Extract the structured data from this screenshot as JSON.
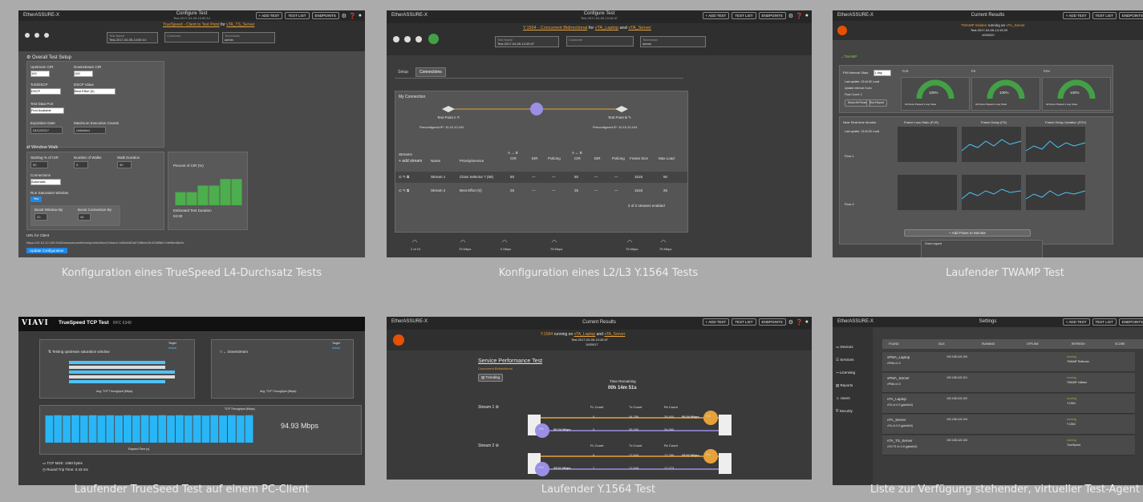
{
  "captions": [
    "Konfiguration eines TrueSpeed L4-Durchsatz Tests",
    "Konfiguration eines L2/L3 Y.1564 Tests",
    "Laufender TWAMP Test",
    "Laufender TrueSeed Test auf einem PC-Client",
    "Laufender Y.1564 Test",
    "Liste zur Verfügung stehender, virtueller Test-Agent"
  ],
  "common": {
    "logo": "EtherASSURE-X",
    "add_test": "+ ADD TEST",
    "test_list": "TEST LIST",
    "endpoints": "ENDPOINTS"
  },
  "s1": {
    "title": "Configure Test",
    "subtitle": "Test-2017-04-05-13:50:14",
    "heading_a": "TrueSpeed - Client to Test Point",
    "heading_for": "for",
    "heading_b": "vTA_TS_Server",
    "test_name_label": "Test Name",
    "test_name_value": "Test-2017-04-05-13:50:14",
    "customer_label": "Customer",
    "technician_label": "Technician",
    "technician_value": "admin",
    "setup_title": "Overall Test Setup",
    "upstream_cir_label": "Upstream CIR",
    "upstream_cir_value": "100",
    "downstream_cir_label": "Downstream CIR",
    "downstream_cir_value": "100",
    "tos_label": "ToS/DSCP",
    "tos_value": "DSCP",
    "dscp_label": "DSCP Value",
    "dscp_value": "Best Effort (0)",
    "port_label": "Test Data Port",
    "port_value": "First Available",
    "expiration_label": "Expiration Date",
    "expiration_value": "04/12/2017",
    "max_exec_label": "Maximum Execution Counts",
    "max_exec_value": "Unlimited",
    "window_title": "Window Walk",
    "starting_label": "Starting % of CIR",
    "starting_value": "50",
    "steps_label": "Number of Walks",
    "steps_value": "3",
    "walk_dur_label": "Walk Duration",
    "walk_dur_value": "30",
    "connections_label": "Connections",
    "connections_value": "Automatic",
    "saturation_label": "Run Saturation Window",
    "saturation_value": "Yes",
    "boost_window_label": "Boost Window By",
    "boost_window_value": "20",
    "boost_conn_label": "Boost Connection By",
    "boost_conn_value": "40",
    "percent_cir_label": "Percent of CIR (%)",
    "est_duration_label": "Estimated Test Duration",
    "est_duration_value": "04:30",
    "url_label": "URL for Client",
    "url_value": "https://10.10.10.100:9443/assurance/ethersi/public/#/tool?shard=1d5b4d52a0748bee2fc1f1f858c7cfe56ed5e9c",
    "update_button": "Update Configuration",
    "chart_data": {
      "type": "bar",
      "categories": [
        "1",
        "2",
        "3",
        "4",
        "5",
        "6"
      ],
      "values": [
        50,
        50,
        75,
        75,
        100,
        100
      ],
      "ylim": [
        0,
        110
      ]
    }
  },
  "s2": {
    "title": "Configure Test",
    "subtitle": "Test-2017-04-05-13:45:37",
    "heading_a": "Y.1564 - Concurrent Bidirectional",
    "heading_for": "for",
    "heading_b": "vTA_Laptop",
    "heading_and": "and",
    "heading_c": "vTA_Server",
    "test_name_label": "Test Name",
    "test_name_value": "Test-2017-04-05-13:45:37",
    "customer_label": "Customer",
    "technician_label": "Technician",
    "technician_value": "admin",
    "tab_setup": "Setup",
    "tab_connections": "Connections",
    "connection_title": "My Connection",
    "tp_a": "Test Point A",
    "tp_b": "Test Point B",
    "ip_a": "Preconfigured IP: 10.10.10.102",
    "ip_b": "Preconfigured IP: 10.10.10.104",
    "col_streams": "Streams",
    "add_stream": "+ add stream",
    "col_name": "Name",
    "col_priority": "Priority/Service",
    "col_cir": "CIR",
    "col_eir": "EIR",
    "col_policing": "Policing",
    "col_frame": "Frame Size",
    "col_maxload": "Max Load",
    "unit": "Mbps",
    "ab": "A → B",
    "ba": "A ← B",
    "streams": [
      {
        "name": "Stream 1",
        "priority": "Class Selector 7 (56)",
        "cir": "50",
        "eir": "—",
        "policing": "—",
        "cir2": "50",
        "eir2": "—",
        "policing2": "—",
        "frame": "1518",
        "maxload": "50"
      },
      {
        "name": "Stream 2",
        "priority": "Best Effort (0)",
        "cir": "25",
        "eir": "—",
        "policing": "—",
        "cir2": "25",
        "eir2": "—",
        "policing2": "—",
        "frame": "1518",
        "maxload": "25"
      }
    ],
    "enabled_text": "2 of 2 streams enabled",
    "gauge_labels": [
      "2 of 10",
      "75 Mbps",
      "0 Mbps",
      "75 Mbps",
      "75 Mbps",
      "75 Mbps"
    ]
  },
  "s3": {
    "title": "Current Results",
    "running": "TWAMP Initiator",
    "running_on": "running on",
    "running_agent": "vTA_Server",
    "timestamp": "Test-2017-04-05-14:15:29",
    "test_id": "1000020",
    "menu": "TWAMP",
    "interval_label": "FMI Interval Stats",
    "interval_value": "1 day",
    "last_update": "Last update: 13:44:30 Local",
    "update_interval": "Update interval: 5 sec",
    "flow_count": "Flow Count: 2",
    "show_all": "Show All Flows",
    "run_report": "Run Report",
    "flr_label": "FLR",
    "fd_label": "FD",
    "fdv_label": "FDV",
    "gauge_value": "100%",
    "gauge_caption": "All Flows Passed 1 way Stats",
    "monitor_title": "Near Real-time Monitor",
    "monitor_cols": [
      "Frame Loss Ratio (FLR)",
      "Frame Delay (FD)",
      "Frame Delay Variation (FDV)"
    ],
    "monitor_update": "Last update: 13:44:30 Local",
    "flow1": "Flow 1",
    "flow2": "Flow 2",
    "add_flows": "+ Add Flows to Monitor",
    "legend_title": "Chart Legend"
  },
  "s4": {
    "brand": "VIAVI",
    "title": "TrueSpeed TCP Test",
    "rfc": "RFC 6349",
    "upstream_label": "Testing upstream saturation window",
    "downstream_label": "Downstream",
    "target": "Target",
    "actual": "Actual",
    "xlabel_top": "Avg. TCP Throughput (Mbps)",
    "throughput_title": "TCP Throughput (Mbps)",
    "throughput_value": "94.93 Mbps",
    "xlabel_bottom": "Elapsed Time (s)",
    "mss": "TCP MSS: 1460 bytes",
    "rtt": "Round Trip Time: 0.43 ms",
    "chart_data": {
      "type": "bar",
      "title": "TCP Throughput (Mbps)",
      "xlabel": "Elapsed Time (s)",
      "values": [
        94,
        95,
        94,
        95,
        94,
        95,
        94,
        95,
        94,
        95,
        94,
        95,
        94,
        95,
        94,
        95,
        94,
        95,
        94,
        95,
        94,
        95,
        94,
        95
      ],
      "ylim": [
        0,
        100
      ]
    }
  },
  "s5": {
    "title": "Current Results",
    "heading_a": "Y.1564",
    "running_on": "running on",
    "heading_b": "vTA_Laptop",
    "heading_and": "and",
    "heading_c": "vTA_Server",
    "timestamp": "Test-2017-04-05-13:45:37",
    "test_id": "1000017",
    "spt_title": "Service Performance Test",
    "spt_sub": "Concurrent Bidirectional",
    "trending": "Trending",
    "time_remaining_label": "Time Remaining",
    "time_remaining": "00h 14m 51s",
    "stream1": "Stream 1",
    "stream2": "Stream 2",
    "fl_count": "FL Count",
    "tx_count": "Tx Count",
    "rx_count": "Rx Count",
    "s1_up": {
      "fl": "0",
      "tx": "34,788",
      "rx": "35,400",
      "rate": "50.04 Mbps"
    },
    "s1_down": {
      "fl": "0",
      "tx": "35,390",
      "rx": "34,960",
      "rate": "50.04 Mbps"
    },
    "s2_up": {
      "fl": "9",
      "tx": "17,840",
      "rx": "17,789",
      "rate": "25.02 Mbps"
    },
    "s2_down": {
      "fl": "7",
      "tx": "17,648",
      "rx": "17,273",
      "rate": "25.01 Mbps"
    },
    "pct_a": "0%",
    "pct_b": "0%",
    "pct_c": "0%",
    "pct_d": "<1%",
    "flr": "FLR"
  },
  "s6": {
    "title": "Settings",
    "menu": [
      "Devices",
      "Services",
      "Licensing",
      "Reports",
      "Users",
      "Security"
    ],
    "header_tabs": [
      "FOUND",
      "IDLE",
      "RUNNING",
      "OFFLINE",
      "REFRESH",
      "SCORE"
    ],
    "agents": [
      {
        "name": "vPMA_Laptop",
        "ver": "vPMA v1.0",
        "ip": "192.168.115.100",
        "status": "running",
        "detail": "TWAMP Reflector"
      },
      {
        "name": "vPMA_Server",
        "ver": "vPMA v1.0",
        "ip": "192.168.115.101",
        "status": "running",
        "detail": "TWAMP Initiator"
      },
      {
        "name": "vTA_Laptop",
        "ver": "vTA v1.0.0 (gsto644)",
        "ip": "192.168.115.102",
        "status": "running",
        "detail": "Y.1564"
      },
      {
        "name": "vTA_Server",
        "ver": "vTA v1.0.0 (gsto644)",
        "ip": "192.168.115.104",
        "status": "running",
        "detail": "Y.1564"
      },
      {
        "name": "vTA_TS_Server",
        "ver": "vTA TS v1.0.0 (gsto644)",
        "ip": "192.168.115.105",
        "status": "running",
        "detail": "TrueSpeed"
      }
    ]
  }
}
